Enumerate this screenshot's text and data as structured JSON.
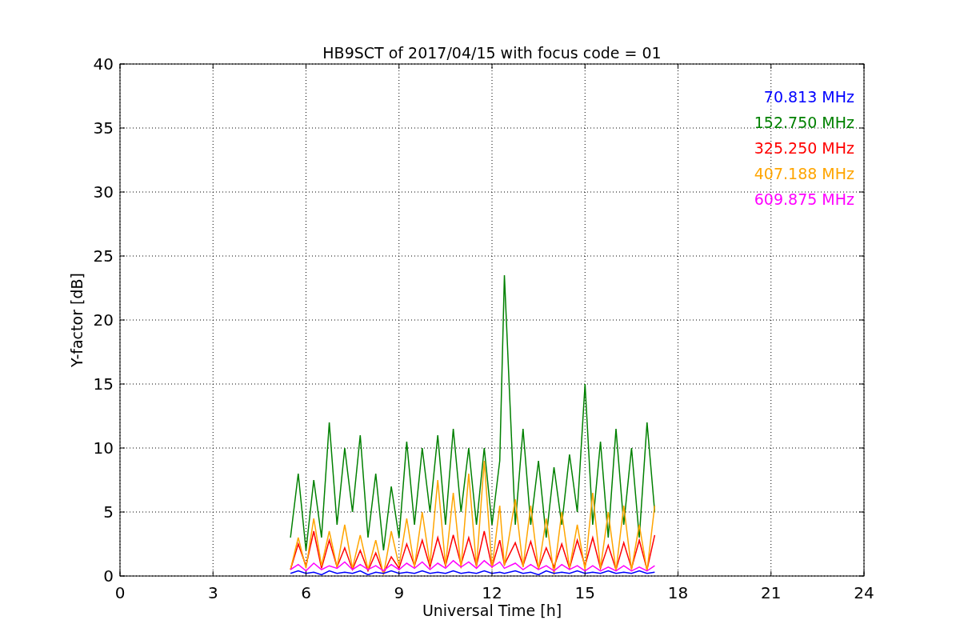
{
  "figure": {
    "chart_data": {
      "type": "line",
      "title": "HB9SCT of 2017/04/15 with focus code = 01",
      "xlabel": "Universal Time [h]",
      "ylabel": "Y-factor [dB]",
      "x": [
        5.5,
        5.75,
        6,
        6.25,
        6.5,
        6.75,
        7,
        7.25,
        7.5,
        7.75,
        8,
        8.25,
        8.5,
        8.75,
        9,
        9.25,
        9.5,
        9.75,
        10,
        10.25,
        10.5,
        10.75,
        11,
        11.25,
        11.5,
        11.75,
        12,
        12.25,
        12.4,
        12.75,
        13,
        13.25,
        13.5,
        13.75,
        14,
        14.25,
        14.5,
        14.75,
        15,
        15.25,
        15.5,
        15.75,
        16,
        16.25,
        16.5,
        16.75,
        17,
        17.25
      ],
      "series": [
        {
          "name": "70.813 MHz",
          "color": "#0000ff",
          "values": [
            0.2,
            0.4,
            0.2,
            0.3,
            0.1,
            0.4,
            0.2,
            0.3,
            0.2,
            0.4,
            0.1,
            0.3,
            0.2,
            0.4,
            0.2,
            0.3,
            0.2,
            0.4,
            0.2,
            0.3,
            0.2,
            0.4,
            0.2,
            0.3,
            0.2,
            0.4,
            0.2,
            0.3,
            0.2,
            0.4,
            0.2,
            0.3,
            0.1,
            0.4,
            0.2,
            0.3,
            0.2,
            0.4,
            0.2,
            0.3,
            0.2,
            0.4,
            0.2,
            0.3,
            0.2,
            0.4,
            0.2,
            0.3
          ]
        },
        {
          "name": "152.750 MHz",
          "color": "#008000",
          "values": [
            3,
            8,
            2,
            7.5,
            3,
            12,
            4,
            10,
            5,
            11,
            3,
            8,
            2,
            7,
            3,
            10.5,
            4,
            10,
            5,
            11,
            4,
            11.5,
            5,
            10,
            4,
            10,
            4,
            9,
            23.5,
            4,
            11.5,
            4,
            9,
            3,
            8.5,
            4,
            9.5,
            5,
            15,
            4,
            10.5,
            3,
            11.5,
            4,
            10,
            3,
            12,
            5
          ]
        },
        {
          "name": "325.250 MHz",
          "color": "#ff0000",
          "values": [
            0.5,
            2.5,
            0.8,
            3.5,
            0.6,
            2.8,
            0.7,
            2.2,
            0.5,
            2,
            0.4,
            1.8,
            0.2,
            1.5,
            0.6,
            2.5,
            0.8,
            2.8,
            0.7,
            3,
            0.8,
            3.2,
            0.9,
            3,
            0.8,
            3.5,
            0.7,
            2.8,
            0.9,
            2.6,
            0.8,
            2.7,
            0.6,
            2.2,
            0.7,
            2.5,
            0.6,
            2.8,
            0.8,
            3,
            0.6,
            2.4,
            0.5,
            2.6,
            0.6,
            2.8,
            0.5,
            3.2
          ]
        },
        {
          "name": "407.188 MHz",
          "color": "#ffa500",
          "values": [
            0.5,
            3,
            0.6,
            4.5,
            0.8,
            3.5,
            0.7,
            4,
            0.6,
            3.2,
            0.5,
            2.8,
            0.1,
            3.5,
            0.8,
            4.5,
            0.7,
            5,
            0.9,
            7.5,
            0.8,
            6.5,
            0.6,
            8,
            0.7,
            9,
            0.6,
            5.5,
            0.8,
            6,
            0.7,
            5.5,
            0.5,
            4.5,
            0.1,
            5,
            0.6,
            4,
            0.5,
            6.5,
            0.6,
            5,
            0.4,
            5.5,
            0.5,
            4,
            0.4,
            5.5
          ]
        },
        {
          "name": "609.875 MHz",
          "color": "#ff00ff",
          "values": [
            0.5,
            0.9,
            0.4,
            1,
            0.5,
            0.8,
            0.6,
            1.1,
            0.5,
            0.9,
            0.5,
            0.8,
            0.4,
            0.9,
            0.5,
            1,
            0.6,
            1.1,
            0.5,
            1,
            0.6,
            1.2,
            0.7,
            1.1,
            0.6,
            1.2,
            0.7,
            1.1,
            0.6,
            1,
            0.5,
            0.9,
            0.5,
            0.8,
            0.4,
            0.9,
            0.5,
            0.8,
            0.4,
            0.8,
            0.4,
            0.7,
            0.4,
            0.8,
            0.4,
            0.7,
            0.4,
            0.8
          ]
        }
      ],
      "xlim": [
        0,
        24
      ],
      "ylim": [
        0,
        40
      ],
      "xticks": [
        0,
        3,
        6,
        9,
        12,
        15,
        18,
        21,
        24
      ],
      "yticks": [
        0,
        5,
        10,
        15,
        20,
        25,
        30,
        35,
        40
      ],
      "grid": true
    }
  }
}
